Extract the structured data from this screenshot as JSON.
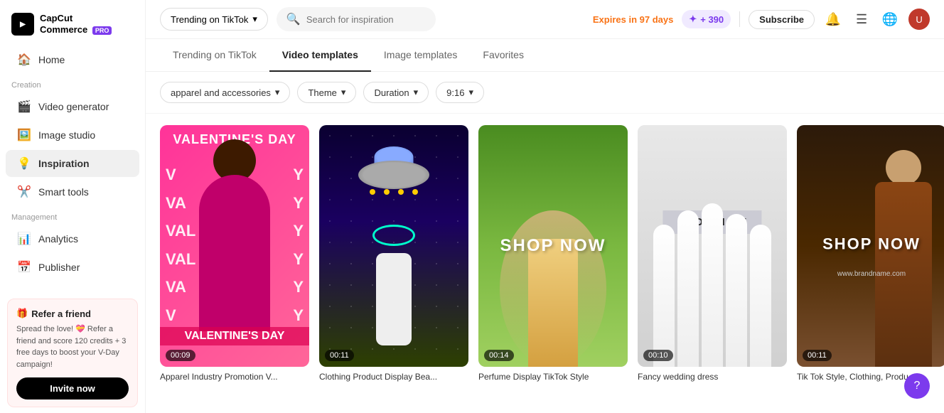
{
  "brand": {
    "name": "CapCut",
    "sub": "Commerce",
    "pro_label": "PRO"
  },
  "sidebar": {
    "nav_items": [
      {
        "id": "home",
        "label": "Home",
        "icon": "🏠"
      },
      {
        "id": "video-generator",
        "label": "Video generator",
        "icon": "🎬",
        "section": "Creation"
      },
      {
        "id": "image-studio",
        "label": "Image studio",
        "icon": "🖼️"
      },
      {
        "id": "inspiration",
        "label": "Inspiration",
        "icon": "💡",
        "active": true
      },
      {
        "id": "smart-tools",
        "label": "Smart tools",
        "icon": "✂️"
      },
      {
        "id": "analytics",
        "label": "Analytics",
        "icon": "📊",
        "section": "Management"
      },
      {
        "id": "publisher",
        "label": "Publisher",
        "icon": "📅"
      }
    ],
    "sections": {
      "creation": "Creation",
      "management": "Management"
    },
    "refer": {
      "title": "Refer a friend",
      "icon": "🎁",
      "description": "Spread the love! 💝 Refer a friend and score 120 credits + 3 free days to boost your V-Day campaign!",
      "invite_label": "Invite now"
    }
  },
  "header": {
    "trending_label": "Trending on TikTok",
    "search_placeholder": "Search for inspiration",
    "expires_text": "Expires in 97 days",
    "credits": "+ 390",
    "subscribe_label": "Subscribe"
  },
  "tabs": [
    {
      "id": "trending",
      "label": "Trending on TikTok"
    },
    {
      "id": "video-templates",
      "label": "Video templates",
      "active": true
    },
    {
      "id": "image-templates",
      "label": "Image templates"
    },
    {
      "id": "favorites",
      "label": "Favorites"
    }
  ],
  "filters": [
    {
      "id": "category",
      "label": "apparel and accessories"
    },
    {
      "id": "theme",
      "label": "Theme"
    },
    {
      "id": "duration",
      "label": "Duration"
    },
    {
      "id": "ratio",
      "label": "9:16"
    }
  ],
  "templates": [
    {
      "id": "t1",
      "title": "Apparel Industry Promotion V...",
      "duration": "00:09",
      "style": "valentines",
      "overlay_text": "VALENTINE'S DAY",
      "side_letters": "V\nVA\nVAL\nVAL\nVA\nV",
      "side_y": "Y\nY\nY\nY\nY\nY",
      "bottom_text": "VALENTINE'S DAY"
    },
    {
      "id": "t2",
      "title": "Clothing Product Display Bea...",
      "duration": "00:11",
      "style": "ufo"
    },
    {
      "id": "t3",
      "title": "Perfume Display TikTok Style",
      "duration": "00:14",
      "style": "greenfield",
      "shop_text": "SHOP NOW"
    },
    {
      "id": "t4",
      "title": "Fancy wedding dress",
      "duration": "00:10",
      "style": "wedding",
      "shop_text": "SHOP NOW"
    },
    {
      "id": "t5",
      "title": "Tik Tok Style, Clothing, Produ...",
      "duration": "00:11",
      "style": "darkmale",
      "shop_text": "SHOP NOW",
      "website": "www.brandname.com"
    }
  ]
}
